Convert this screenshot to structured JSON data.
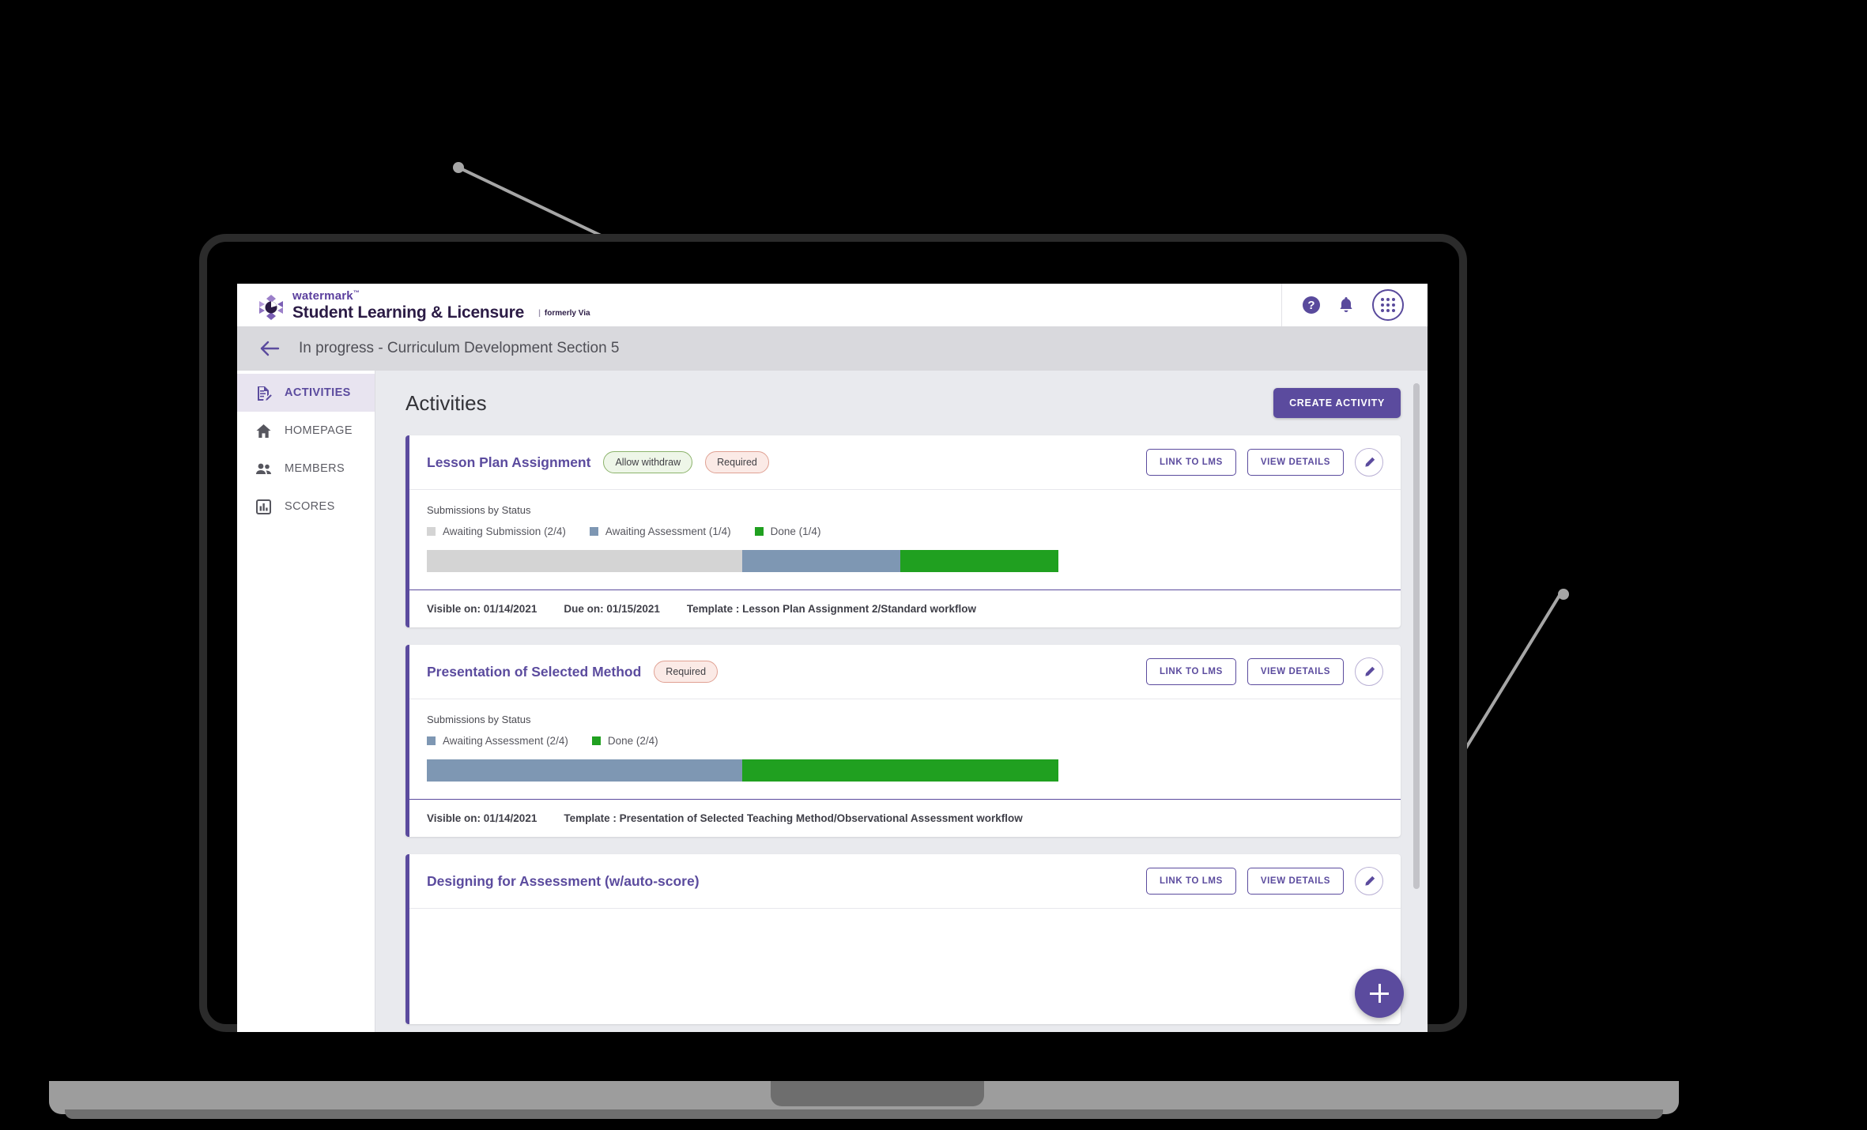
{
  "brand": {
    "top": "watermark",
    "tm": "™",
    "main": "Student Learning & Licensure",
    "divider": "|",
    "sub": "formerly Via"
  },
  "header": {
    "help_icon": "help-circle-icon",
    "bell_icon": "bell-icon",
    "apps_icon": "app-grid-icon"
  },
  "sub_header": {
    "back_icon": "back-arrow-icon",
    "title": "In progress - Curriculum Development Section 5"
  },
  "sidebar": {
    "items": [
      {
        "label": "ACTIVITIES",
        "icon": "document-edit-icon",
        "active": true
      },
      {
        "label": "HOMEPAGE",
        "icon": "home-icon",
        "active": false
      },
      {
        "label": "MEMBERS",
        "icon": "people-icon",
        "active": false
      },
      {
        "label": "SCORES",
        "icon": "bar-chart-icon",
        "active": false
      }
    ]
  },
  "main": {
    "page_title": "Activities",
    "create_button": "CREATE ACTIVITY",
    "fab_label": "+",
    "section_label": "Submissions by Status",
    "buttons": {
      "link_lms": "LINK TO LMS",
      "view_details": "VIEW DETAILS",
      "edit_icon": "pencil-icon"
    },
    "activities": [
      {
        "title": "Lesson Plan Assignment",
        "badges": [
          {
            "text": "Allow withdraw",
            "style": "green"
          },
          {
            "text": "Required",
            "style": "red"
          }
        ],
        "visible_on": "Visible on: 01/14/2021",
        "due_on": "Due on: 01/15/2021",
        "template": "Template : Lesson Plan Assignment 2/Standard workflow",
        "chart_data": {
          "type": "bar",
          "title": "Submissions by Status",
          "orientation": "horizontal-stacked",
          "total": 4,
          "categories": [
            "Awaiting Submission",
            "Awaiting Assessment",
            "Done"
          ],
          "values": [
            2,
            1,
            1
          ],
          "labels": [
            "Awaiting Submission (2/4)",
            "Awaiting Assessment (1/4)",
            "Done (1/4)"
          ],
          "colors": [
            "#d4d4d4",
            "#7e97b3",
            "#20a020"
          ],
          "legend_position": "top"
        }
      },
      {
        "title": "Presentation of Selected Method",
        "badges": [
          {
            "text": "Required",
            "style": "red"
          }
        ],
        "visible_on": "Visible on: 01/14/2021",
        "due_on": "",
        "template": "Template : Presentation of Selected Teaching Method/Observational Assessment workflow",
        "chart_data": {
          "type": "bar",
          "title": "Submissions by Status",
          "orientation": "horizontal-stacked",
          "total": 4,
          "categories": [
            "Awaiting Assessment",
            "Done"
          ],
          "values": [
            2,
            2
          ],
          "labels": [
            "Awaiting Assessment (2/4)",
            "Done (2/4)"
          ],
          "colors": [
            "#7e97b3",
            "#20a020"
          ],
          "legend_position": "top"
        }
      },
      {
        "title": "Designing for Assessment (w/auto-score)",
        "badges": [],
        "visible_on": "",
        "due_on": "",
        "template": "",
        "chart_data": null
      }
    ]
  },
  "colors": {
    "brand_purple": "#5b4b9e",
    "status_awaiting_submission": "#d4d4d4",
    "status_awaiting_assessment": "#7e97b3",
    "status_done": "#20a020",
    "badge_green_bg": "#eef6e8",
    "badge_red_bg": "#fbeae6"
  }
}
